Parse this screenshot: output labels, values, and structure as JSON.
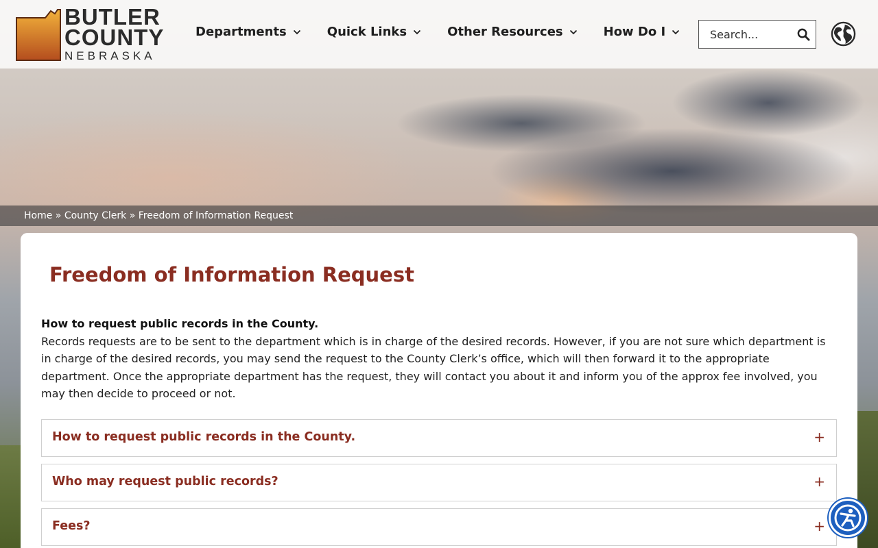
{
  "site": {
    "logo_line1": "BUTLER",
    "logo_line2": "COUNTY",
    "logo_line3": "NEBRASKA"
  },
  "nav": {
    "items": [
      {
        "label": "Departments"
      },
      {
        "label": "Quick Links"
      },
      {
        "label": "Other Resources"
      },
      {
        "label": "How Do I"
      }
    ]
  },
  "search": {
    "placeholder": "Search..."
  },
  "breadcrumb": {
    "home": "Home",
    "sep": "»",
    "parent": "County Clerk",
    "current": "Freedom of Information Request"
  },
  "main": {
    "title": "Freedom of Information Request",
    "lead": "How to request public records in the County.",
    "body": "Records requests are to be sent to the department which is in charge of the desired records. However, if you are not sure which department is in charge of the desired records, you may send the request to the County Clerk’s office, which will then forward it to the appropriate department. Once the appropriate department has the request, they will contact you about it and inform you of the approx fee involved, you may then decide to proceed or not.",
    "accordion": [
      {
        "label": "How to request public records in the County.",
        "toggle": "+"
      },
      {
        "label": "Who may request public records?",
        "toggle": "+"
      },
      {
        "label": "Fees?",
        "toggle": "+"
      }
    ]
  },
  "colors": {
    "accent": "#8a2d21",
    "accessibility_button": "#1d5fbf"
  },
  "icons": {
    "nav_chevron": "chevron-down-icon",
    "search": "search-icon",
    "language": "globe-icon",
    "accessibility": "accessibility-icon"
  }
}
